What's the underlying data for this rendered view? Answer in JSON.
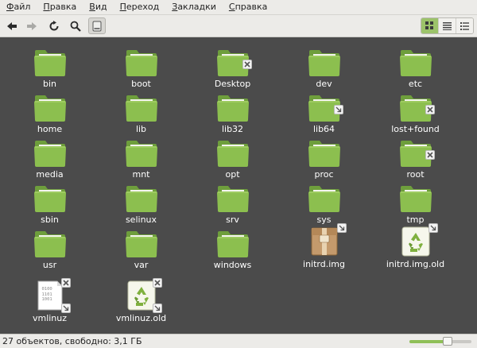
{
  "menubar": {
    "items": [
      {
        "accel": "Ф",
        "rest": "айл"
      },
      {
        "accel": "П",
        "rest": "равка"
      },
      {
        "accel": "В",
        "rest": "ид"
      },
      {
        "accel": "П",
        "rest": "ереход"
      },
      {
        "accel": "З",
        "rest": "акладки"
      },
      {
        "accel": "С",
        "rest": "правка"
      }
    ]
  },
  "toolbar": {
    "buttons": [
      {
        "icon": "back-arrow-icon"
      },
      {
        "icon": "forward-arrow-icon"
      },
      {
        "icon": "reload-icon"
      },
      {
        "icon": "search-icon"
      },
      {
        "icon": "drive-icon"
      }
    ],
    "views": [
      {
        "icon": "icon-view-icon",
        "active": true
      },
      {
        "icon": "list-view-icon",
        "active": false
      },
      {
        "icon": "compact-view-icon",
        "active": false
      }
    ]
  },
  "files": [
    {
      "name": "bin",
      "type": "folder",
      "emblem": null
    },
    {
      "name": "boot",
      "type": "folder",
      "emblem": null
    },
    {
      "name": "Desktop",
      "type": "folder",
      "emblem": "x"
    },
    {
      "name": "dev",
      "type": "folder",
      "emblem": null
    },
    {
      "name": "etc",
      "type": "folder",
      "emblem": null
    },
    {
      "name": "home",
      "type": "folder",
      "emblem": null
    },
    {
      "name": "lib",
      "type": "folder",
      "emblem": null
    },
    {
      "name": "lib32",
      "type": "folder",
      "emblem": null
    },
    {
      "name": "lib64",
      "type": "folder",
      "emblem": "link"
    },
    {
      "name": "lost+found",
      "type": "folder",
      "emblem": "x"
    },
    {
      "name": "media",
      "type": "folder",
      "emblem": null
    },
    {
      "name": "mnt",
      "type": "folder",
      "emblem": null
    },
    {
      "name": "opt",
      "type": "folder",
      "emblem": null
    },
    {
      "name": "proc",
      "type": "folder",
      "emblem": null
    },
    {
      "name": "root",
      "type": "folder",
      "emblem": "x"
    },
    {
      "name": "sbin",
      "type": "folder",
      "emblem": null
    },
    {
      "name": "selinux",
      "type": "folder",
      "emblem": null
    },
    {
      "name": "srv",
      "type": "folder",
      "emblem": null
    },
    {
      "name": "sys",
      "type": "folder",
      "emblem": null
    },
    {
      "name": "tmp",
      "type": "folder",
      "emblem": null
    },
    {
      "name": "usr",
      "type": "folder",
      "emblem": null
    },
    {
      "name": "var",
      "type": "folder",
      "emblem": null
    },
    {
      "name": "windows",
      "type": "folder",
      "emblem": null
    },
    {
      "name": "initrd.img",
      "type": "package",
      "emblem": "link"
    },
    {
      "name": "initrd.img.old",
      "type": "recycle",
      "emblem": "link"
    },
    {
      "name": "vmlinuz",
      "type": "binary",
      "emblem": "x+link",
      "binary_text": [
        "0100",
        "1101",
        "1001"
      ]
    },
    {
      "name": "vmlinuz.old",
      "type": "recycle",
      "emblem": "x+link"
    }
  ],
  "status": {
    "text": "27 объектов, свободно: 3,1 ГБ",
    "zoom_level": 0.62
  },
  "colors": {
    "folder": "#8cbf4f",
    "folder_dark": "#6e9e3c",
    "background": "#4b4b4b",
    "accent": "#9cc36a"
  }
}
